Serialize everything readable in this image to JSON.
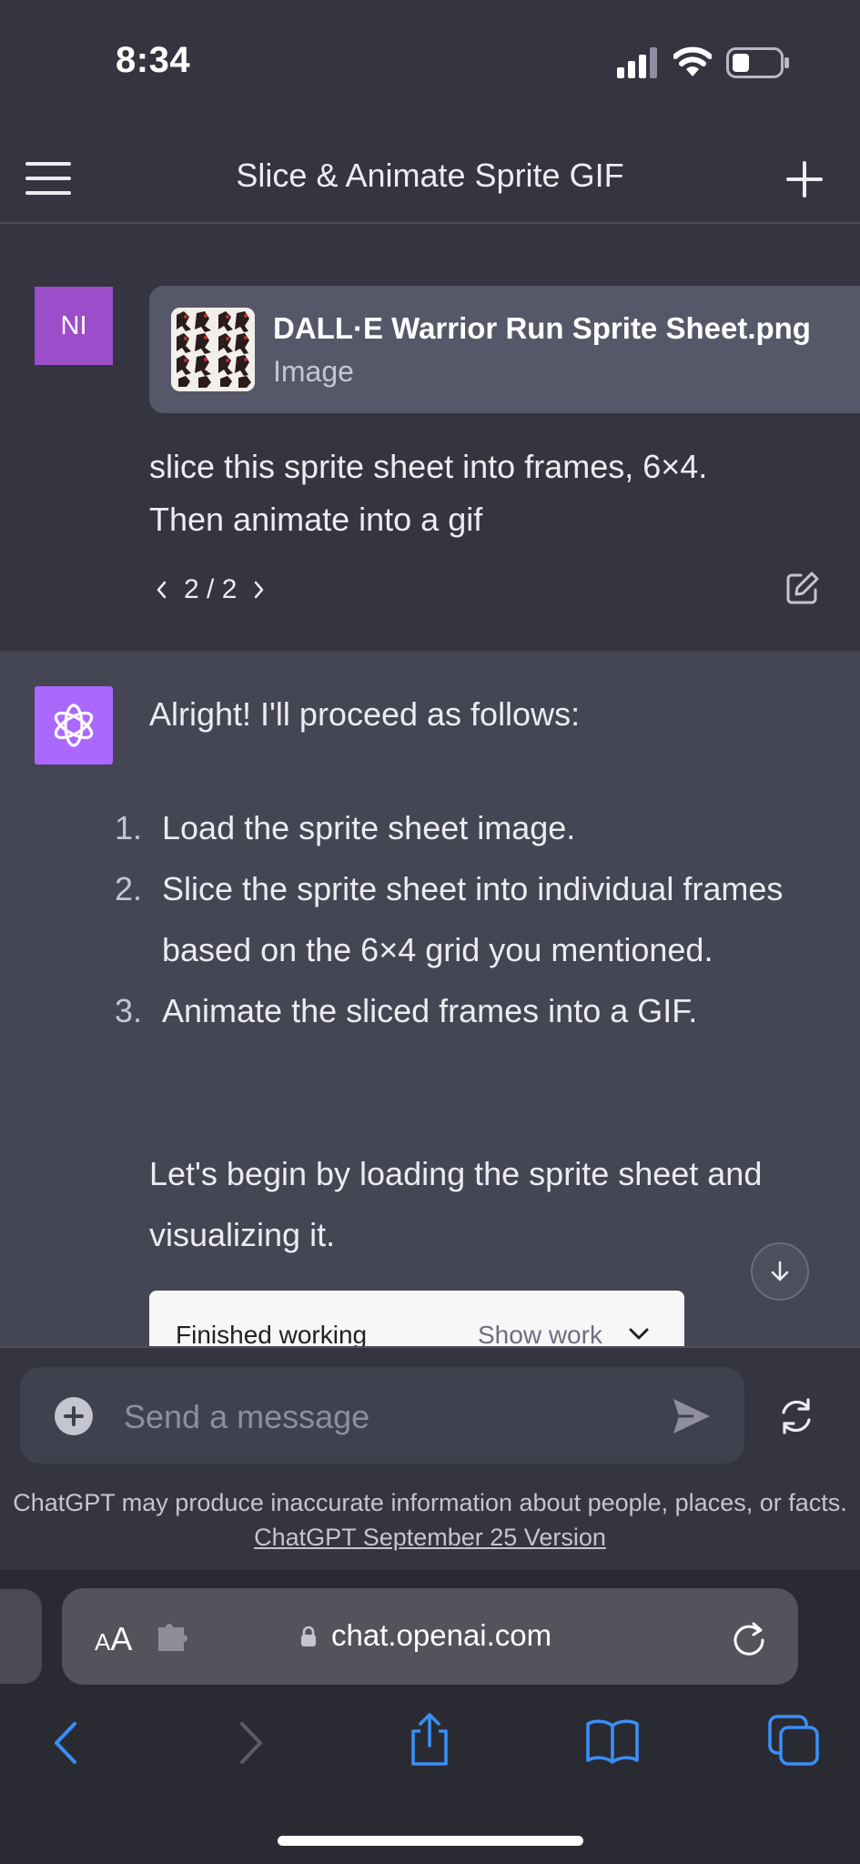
{
  "status_bar": {
    "time": "8:34"
  },
  "header": {
    "title": "Slice & Animate Sprite GIF"
  },
  "user_message": {
    "avatar_initials": "NI",
    "attachment": {
      "name": "DALL·E Warrior Run Sprite Sheet.png",
      "type": "Image"
    },
    "text": "slice this sprite sheet into frames, 6×4. Then animate into a gif",
    "version": "2 / 2"
  },
  "assistant_message": {
    "intro": "Alright! I'll proceed as follows:",
    "steps": [
      {
        "num": "1.",
        "text": "Load the sprite sheet image."
      },
      {
        "num": "2.",
        "text": "Slice the sprite sheet into individual frames based on the 6×4 grid you mentioned."
      },
      {
        "num": "3.",
        "text": "Animate the sliced frames into a GIF."
      }
    ],
    "outro": "Let's begin by loading the sprite sheet and visualizing it.",
    "work_card": {
      "status": "Finished working",
      "toggle": "Show work"
    }
  },
  "composer": {
    "placeholder": "Send a message",
    "disclaimer": "ChatGPT may produce inaccurate information about people, places, or facts.",
    "version_link": "ChatGPT September 25 Version"
  },
  "browser": {
    "text_size_label_small": "A",
    "text_size_label_large": "A",
    "url": "chat.openai.com"
  },
  "colors": {
    "background": "#343541",
    "assistant_background": "#444654",
    "user_avatar": "#9b4dca",
    "assistant_avatar": "#ab68ff",
    "safari_accent": "#3a8ef6"
  },
  "icons": [
    "menu-icon",
    "plus-icon",
    "edit-icon",
    "openai-logo-icon",
    "arrow-down-icon",
    "chevron-down-icon",
    "plus-circle-icon",
    "send-icon",
    "regenerate-icon",
    "extensions-icon",
    "lock-icon",
    "reload-icon",
    "back-icon",
    "forward-icon",
    "share-icon",
    "bookmarks-icon",
    "tabs-icon"
  ]
}
